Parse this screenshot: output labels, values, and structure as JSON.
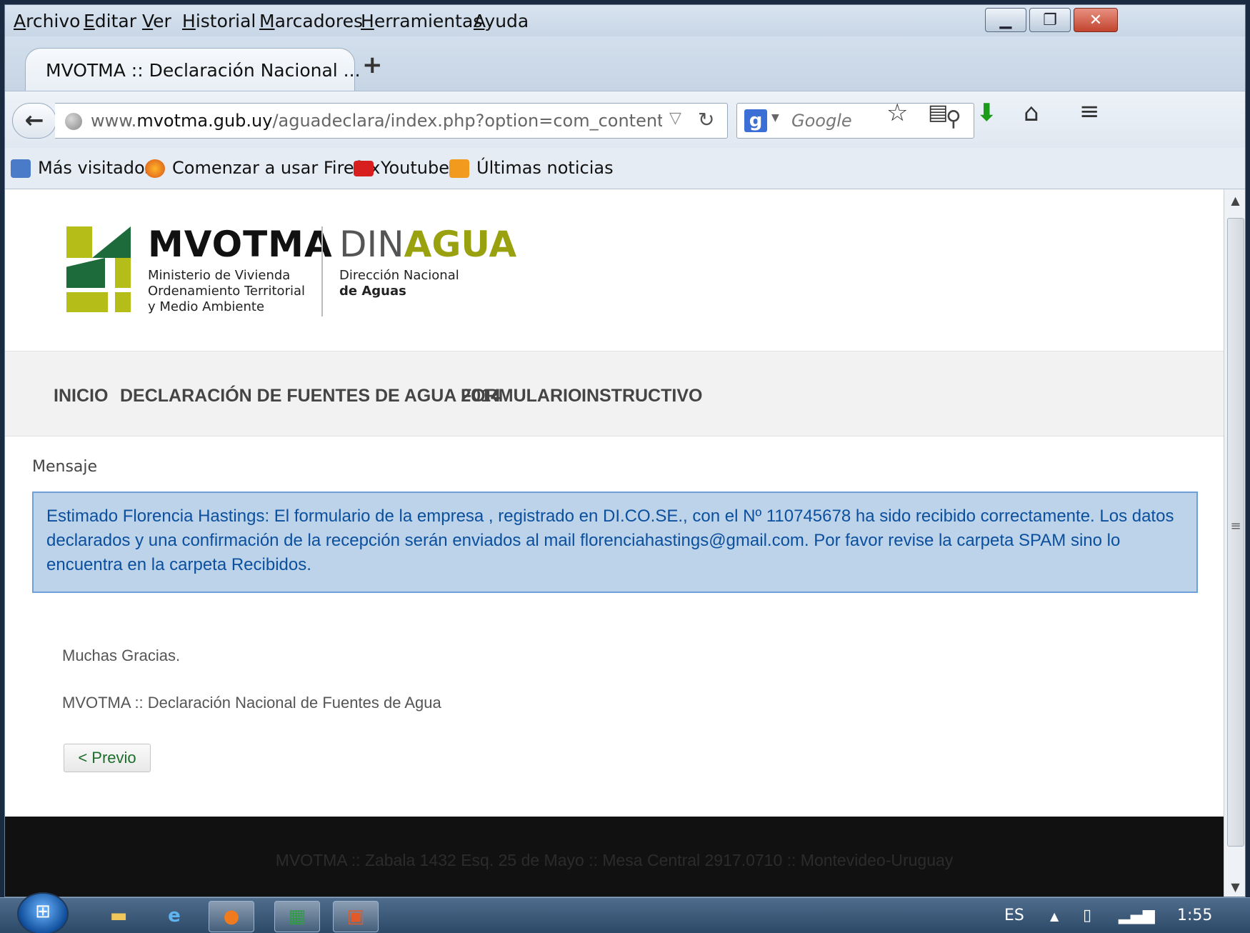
{
  "menubar": {
    "items": [
      "Archivo",
      "Editar",
      "Ver",
      "Historial",
      "Marcadores",
      "Herramientas",
      "Ayuda"
    ]
  },
  "tab": {
    "title": "MVOTMA :: Declaración Nacional ...",
    "new_tab_label": "+"
  },
  "navbar": {
    "url_prefix": "www.",
    "url_domain": "mvotma.gub.uy",
    "url_path": "/aguadeclara/index.php?option=com_content&vie",
    "search_placeholder": "Google"
  },
  "bookmarks": [
    "Más visitados",
    "Comenzar a usar Firefox",
    "Youtube",
    "Últimas noticias"
  ],
  "logo": {
    "title": "MVOTMA",
    "subtitle_lines": [
      "Ministerio de Vivienda",
      "Ordenamiento Territorial",
      "y Medio Ambiente"
    ],
    "din": "DIN",
    "agua": "AGUA",
    "dinagua_lines": [
      "Dirección Nacional",
      "de Aguas"
    ],
    "colors": {
      "green_light": "#b5be18",
      "green_dark": "#1d6b3a",
      "agua": "#9aa10f"
    }
  },
  "site_nav": [
    "INICIO",
    "DECLARACIÓN DE FUENTES DE AGUA 2014",
    "FORMULARIO",
    "INSTRUCTIVO"
  ],
  "message": {
    "heading": "Mensaje",
    "alert_text": "Estimado Florencia Hastings: El formulario de la empresa , registrado en DI.CO.SE., con el Nº 110745678 ha sido recibido correctamente. Los datos declarados y una confirmación de la recepción serán enviados al mail florenciahastings@gmail.com. Por favor revise la carpeta SPAM sino lo encuentra en la carpeta Recibidos.",
    "thanks": "Muchas Gracias.",
    "signature": "MVOTMA :: Declaración Nacional de Fuentes de Agua",
    "prev_button": "< Previo"
  },
  "footer": {
    "text": "MVOTMA :: Zabala 1432 Esq. 25 de Mayo :: Mesa Central 2917.0710 :: Montevideo-Uruguay"
  },
  "taskbar": {
    "language": "ES",
    "time": "1:55"
  }
}
